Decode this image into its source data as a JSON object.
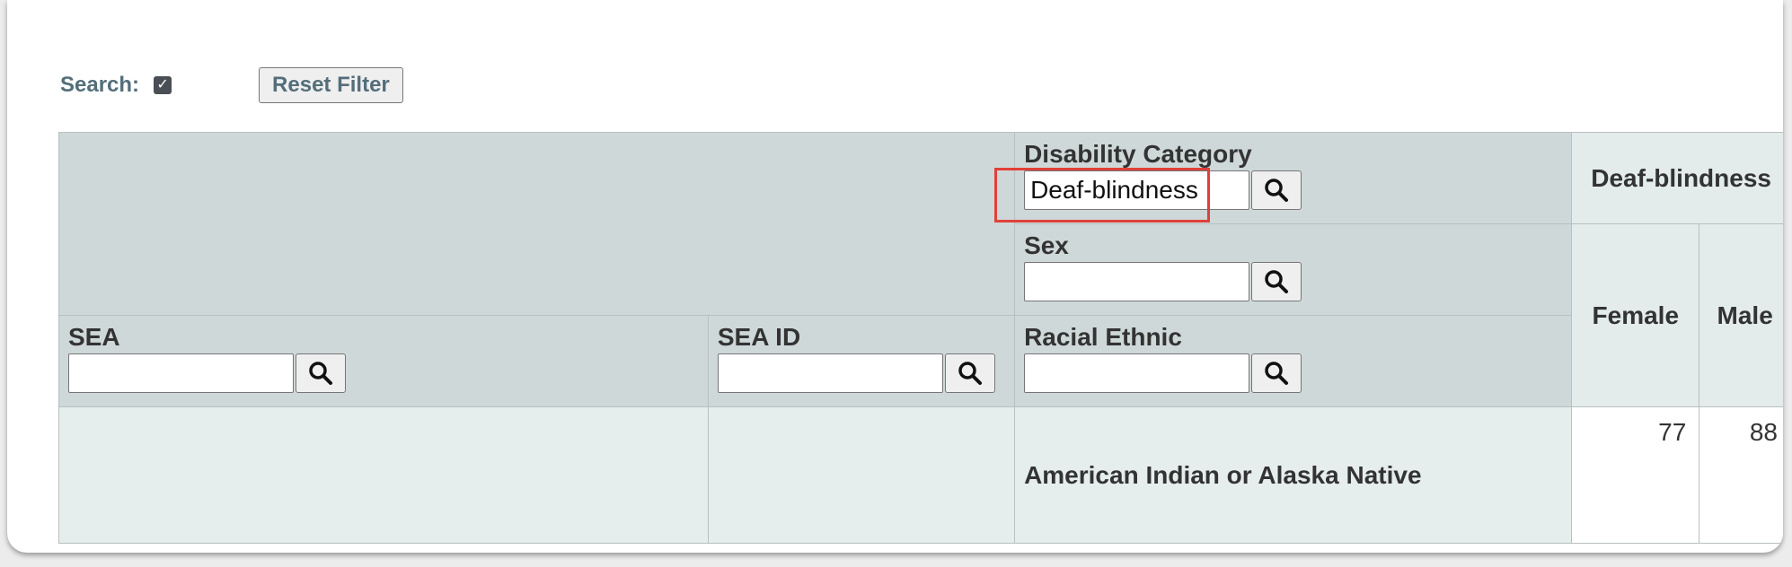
{
  "toolbar": {
    "search_label": "Search:",
    "search_checked": true,
    "reset_label": "Reset Filter"
  },
  "filters": {
    "disability_category": {
      "label": "Disability Category",
      "value": "Deaf-blindness"
    },
    "sex": {
      "label": "Sex",
      "value": ""
    },
    "sea": {
      "label": "SEA",
      "value": ""
    },
    "sea_id": {
      "label": "SEA ID",
      "value": ""
    },
    "racial_ethnic": {
      "label": "Racial Ethnic",
      "value": ""
    }
  },
  "columns": {
    "category_value": "Deaf-blindness",
    "female": "Female",
    "male": "Male"
  },
  "rows": [
    {
      "sea": "",
      "sea_id": "",
      "racial_ethnic": "American Indian or Alaska Native",
      "female": "77",
      "male": "88"
    }
  ],
  "colors": {
    "header_bg": "#cfd8d8",
    "light_bg": "#e3ebeb",
    "highlight": "#e0403a"
  },
  "icons": {
    "search_button": "search-icon",
    "checkbox": "checkmark-icon"
  }
}
